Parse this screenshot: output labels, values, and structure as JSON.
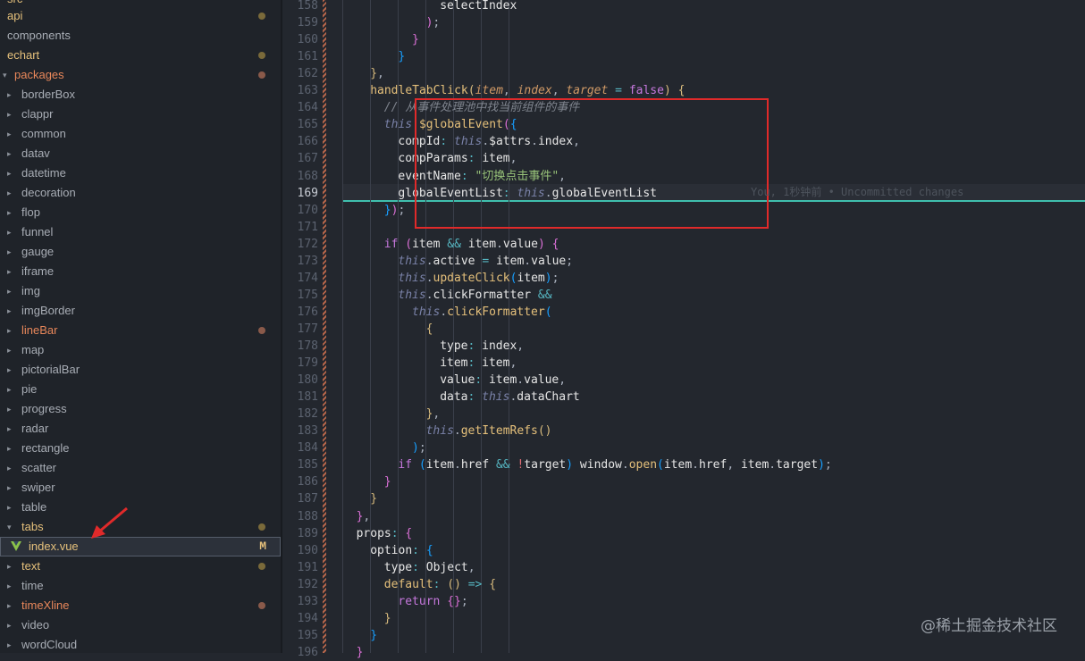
{
  "explorer": {
    "top_partial": "src",
    "items": [
      {
        "label": "api",
        "color": "yellow",
        "dot": "olive",
        "chevron": ""
      },
      {
        "label": "components",
        "color": "default",
        "dot": "",
        "chevron": ""
      },
      {
        "label": "echart",
        "color": "yellow",
        "dot": "olive",
        "chevron": ""
      },
      {
        "label": "packages",
        "color": "orange",
        "dot": "red",
        "chevron": "▾"
      },
      {
        "label": "borderBox",
        "color": "default",
        "dot": "",
        "chevron": "▸"
      },
      {
        "label": "clappr",
        "color": "default",
        "dot": "",
        "chevron": "▸"
      },
      {
        "label": "common",
        "color": "default",
        "dot": "",
        "chevron": "▸"
      },
      {
        "label": "datav",
        "color": "default",
        "dot": "",
        "chevron": "▸"
      },
      {
        "label": "datetime",
        "color": "default",
        "dot": "",
        "chevron": "▸"
      },
      {
        "label": "decoration",
        "color": "default",
        "dot": "",
        "chevron": "▸"
      },
      {
        "label": "flop",
        "color": "default",
        "dot": "",
        "chevron": "▸"
      },
      {
        "label": "funnel",
        "color": "default",
        "dot": "",
        "chevron": "▸"
      },
      {
        "label": "gauge",
        "color": "default",
        "dot": "",
        "chevron": "▸"
      },
      {
        "label": "iframe",
        "color": "default",
        "dot": "",
        "chevron": "▸"
      },
      {
        "label": "img",
        "color": "default",
        "dot": "",
        "chevron": "▸"
      },
      {
        "label": "imgBorder",
        "color": "default",
        "dot": "",
        "chevron": "▸"
      },
      {
        "label": "lineBar",
        "color": "orange",
        "dot": "red",
        "chevron": "▸"
      },
      {
        "label": "map",
        "color": "default",
        "dot": "",
        "chevron": "▸"
      },
      {
        "label": "pictorialBar",
        "color": "default",
        "dot": "",
        "chevron": "▸"
      },
      {
        "label": "pie",
        "color": "default",
        "dot": "",
        "chevron": "▸"
      },
      {
        "label": "progress",
        "color": "default",
        "dot": "",
        "chevron": "▸"
      },
      {
        "label": "radar",
        "color": "default",
        "dot": "",
        "chevron": "▸"
      },
      {
        "label": "rectangle",
        "color": "default",
        "dot": "",
        "chevron": "▸"
      },
      {
        "label": "scatter",
        "color": "default",
        "dot": "",
        "chevron": "▸"
      },
      {
        "label": "swiper",
        "color": "default",
        "dot": "",
        "chevron": "▸"
      },
      {
        "label": "table",
        "color": "default",
        "dot": "",
        "chevron": "▸"
      },
      {
        "label": "tabs",
        "color": "yellow",
        "dot": "olive",
        "chevron": "▾"
      },
      {
        "label": "index.vue",
        "color": "yellow",
        "dot": "",
        "badge": "M",
        "chevron": "",
        "file": true
      },
      {
        "label": "text",
        "color": "yellow",
        "dot": "olive",
        "chevron": "▸"
      },
      {
        "label": "time",
        "color": "default",
        "dot": "",
        "chevron": "▸"
      },
      {
        "label": "timeXline",
        "color": "orange",
        "dot": "red",
        "chevron": "▸"
      },
      {
        "label": "video",
        "color": "default",
        "dot": "",
        "chevron": "▸"
      },
      {
        "label": "wordCloud",
        "color": "default",
        "dot": "",
        "chevron": "▸"
      }
    ]
  },
  "editor": {
    "active_line": "169",
    "blame": "You, 1秒钟前 • Uncommitted changes",
    "lines": [
      {
        "n": "158",
        "indent": 14,
        "tokens": [
          [
            "prop",
            "selectIndex"
          ]
        ]
      },
      {
        "n": "159",
        "indent": 12,
        "tokens": [
          [
            "brace2",
            ")"
          ],
          [
            "pun",
            ";"
          ]
        ]
      },
      {
        "n": "160",
        "indent": 10,
        "tokens": [
          [
            "brace2",
            "}"
          ]
        ]
      },
      {
        "n": "161",
        "indent": 8,
        "tokens": [
          [
            "brace3",
            "}"
          ]
        ]
      },
      {
        "n": "162",
        "indent": 4,
        "tokens": [
          [
            "brace",
            "}"
          ],
          [
            "pun",
            ","
          ]
        ]
      },
      {
        "n": "163",
        "indent": 4,
        "tokens": [
          [
            "fn",
            "handleTabClick"
          ],
          [
            "brace",
            "("
          ],
          [
            "prm",
            "item"
          ],
          [
            "pun",
            ", "
          ],
          [
            "prm",
            "index"
          ],
          [
            "pun",
            ", "
          ],
          [
            "prm",
            "target"
          ],
          [
            "op",
            " = "
          ],
          [
            "kw",
            "false"
          ],
          [
            "brace",
            ")"
          ],
          [
            "pun",
            " "
          ],
          [
            "brace",
            "{"
          ]
        ]
      },
      {
        "n": "164",
        "indent": 6,
        "tokens": [
          [
            "cmt",
            "// 从事件处理池中找当前组件的事件"
          ]
        ]
      },
      {
        "n": "165",
        "indent": 6,
        "tokens": [
          [
            "th",
            "this"
          ],
          [
            "pun",
            "."
          ],
          [
            "fn",
            "$globalEvent"
          ],
          [
            "brace2",
            "("
          ],
          [
            "brace3",
            "{"
          ]
        ]
      },
      {
        "n": "166",
        "indent": 8,
        "tokens": [
          [
            "prop",
            "compId"
          ],
          [
            "op",
            ": "
          ],
          [
            "th",
            "this"
          ],
          [
            "pun",
            "."
          ],
          [
            "prop",
            "$attrs"
          ],
          [
            "pun",
            "."
          ],
          [
            "prop",
            "index"
          ],
          [
            "pun",
            ","
          ]
        ]
      },
      {
        "n": "167",
        "indent": 8,
        "tokens": [
          [
            "prop",
            "compParams"
          ],
          [
            "op",
            ": "
          ],
          [
            "prop",
            "item"
          ],
          [
            "pun",
            ","
          ]
        ]
      },
      {
        "n": "168",
        "indent": 8,
        "tokens": [
          [
            "prop",
            "eventName"
          ],
          [
            "op",
            ": "
          ],
          [
            "str",
            "\"切换点击事件\""
          ],
          [
            "pun",
            ","
          ]
        ]
      },
      {
        "n": "169",
        "indent": 8,
        "tokens": [
          [
            "prop",
            "globalEventList"
          ],
          [
            "op",
            ": "
          ],
          [
            "th",
            "this"
          ],
          [
            "pun",
            "."
          ],
          [
            "prop",
            "globalEventList"
          ]
        ]
      },
      {
        "n": "170",
        "indent": 6,
        "tokens": [
          [
            "brace3",
            "}"
          ],
          [
            "brace2",
            ")"
          ],
          [
            "pun",
            ";"
          ]
        ]
      },
      {
        "n": "171",
        "indent": 0,
        "tokens": []
      },
      {
        "n": "172",
        "indent": 6,
        "tokens": [
          [
            "kw",
            "if"
          ],
          [
            "pun",
            " "
          ],
          [
            "brace2",
            "("
          ],
          [
            "prop",
            "item"
          ],
          [
            "op",
            " && "
          ],
          [
            "prop",
            "item"
          ],
          [
            "pun",
            "."
          ],
          [
            "prop",
            "value"
          ],
          [
            "brace2",
            ")"
          ],
          [
            "pun",
            " "
          ],
          [
            "brace2",
            "{"
          ]
        ]
      },
      {
        "n": "173",
        "indent": 8,
        "tokens": [
          [
            "th",
            "this"
          ],
          [
            "pun",
            "."
          ],
          [
            "prop",
            "active"
          ],
          [
            "op",
            " = "
          ],
          [
            "prop",
            "item"
          ],
          [
            "pun",
            "."
          ],
          [
            "prop",
            "value"
          ],
          [
            "pun",
            ";"
          ]
        ]
      },
      {
        "n": "174",
        "indent": 8,
        "tokens": [
          [
            "th",
            "this"
          ],
          [
            "pun",
            "."
          ],
          [
            "fn",
            "updateClick"
          ],
          [
            "brace3",
            "("
          ],
          [
            "prop",
            "item"
          ],
          [
            "brace3",
            ")"
          ],
          [
            "pun",
            ";"
          ]
        ]
      },
      {
        "n": "175",
        "indent": 8,
        "tokens": [
          [
            "th",
            "this"
          ],
          [
            "pun",
            "."
          ],
          [
            "prop",
            "clickFormatter"
          ],
          [
            "op",
            " &&"
          ]
        ]
      },
      {
        "n": "176",
        "indent": 10,
        "tokens": [
          [
            "th",
            "this"
          ],
          [
            "pun",
            "."
          ],
          [
            "fn",
            "clickFormatter"
          ],
          [
            "brace3",
            "("
          ]
        ]
      },
      {
        "n": "177",
        "indent": 12,
        "tokens": [
          [
            "brace",
            "{"
          ]
        ]
      },
      {
        "n": "178",
        "indent": 14,
        "tokens": [
          [
            "prop",
            "type"
          ],
          [
            "op",
            ": "
          ],
          [
            "prop",
            "index"
          ],
          [
            "pun",
            ","
          ]
        ]
      },
      {
        "n": "179",
        "indent": 14,
        "tokens": [
          [
            "prop",
            "item"
          ],
          [
            "op",
            ": "
          ],
          [
            "prop",
            "item"
          ],
          [
            "pun",
            ","
          ]
        ]
      },
      {
        "n": "180",
        "indent": 14,
        "tokens": [
          [
            "prop",
            "value"
          ],
          [
            "op",
            ": "
          ],
          [
            "prop",
            "item"
          ],
          [
            "pun",
            "."
          ],
          [
            "prop",
            "value"
          ],
          [
            "pun",
            ","
          ]
        ]
      },
      {
        "n": "181",
        "indent": 14,
        "tokens": [
          [
            "prop",
            "data"
          ],
          [
            "op",
            ": "
          ],
          [
            "th",
            "this"
          ],
          [
            "pun",
            "."
          ],
          [
            "prop",
            "dataChart"
          ]
        ]
      },
      {
        "n": "182",
        "indent": 12,
        "tokens": [
          [
            "brace",
            "}"
          ],
          [
            "pun",
            ","
          ]
        ]
      },
      {
        "n": "183",
        "indent": 12,
        "tokens": [
          [
            "th",
            "this"
          ],
          [
            "pun",
            "."
          ],
          [
            "fn",
            "getItemRefs"
          ],
          [
            "brace",
            "()"
          ]
        ]
      },
      {
        "n": "184",
        "indent": 10,
        "tokens": [
          [
            "brace3",
            ")"
          ],
          [
            "pun",
            ";"
          ]
        ]
      },
      {
        "n": "185",
        "indent": 8,
        "tokens": [
          [
            "kw",
            "if"
          ],
          [
            "pun",
            " "
          ],
          [
            "brace3",
            "("
          ],
          [
            "prop",
            "item"
          ],
          [
            "pun",
            "."
          ],
          [
            "prop",
            "href"
          ],
          [
            "op",
            " && "
          ],
          [
            "key",
            "!"
          ],
          [
            "prop",
            "target"
          ],
          [
            "brace3",
            ")"
          ],
          [
            "pun",
            " "
          ],
          [
            "prop",
            "window"
          ],
          [
            "pun",
            "."
          ],
          [
            "fn",
            "open"
          ],
          [
            "brace3",
            "("
          ],
          [
            "prop",
            "item"
          ],
          [
            "pun",
            "."
          ],
          [
            "prop",
            "href"
          ],
          [
            "pun",
            ", "
          ],
          [
            "prop",
            "item"
          ],
          [
            "pun",
            "."
          ],
          [
            "prop",
            "target"
          ],
          [
            "brace3",
            ")"
          ],
          [
            "pun",
            ";"
          ]
        ]
      },
      {
        "n": "186",
        "indent": 6,
        "tokens": [
          [
            "brace2",
            "}"
          ]
        ]
      },
      {
        "n": "187",
        "indent": 4,
        "tokens": [
          [
            "brace",
            "}"
          ]
        ]
      },
      {
        "n": "188",
        "indent": 2,
        "tokens": [
          [
            "brace2",
            "}"
          ],
          [
            "pun",
            ","
          ]
        ]
      },
      {
        "n": "189",
        "indent": 2,
        "tokens": [
          [
            "prop",
            "props"
          ],
          [
            "op",
            ": "
          ],
          [
            "brace2",
            "{"
          ]
        ]
      },
      {
        "n": "190",
        "indent": 4,
        "tokens": [
          [
            "prop",
            "option"
          ],
          [
            "op",
            ": "
          ],
          [
            "brace3",
            "{"
          ]
        ]
      },
      {
        "n": "191",
        "indent": 6,
        "tokens": [
          [
            "prop",
            "type"
          ],
          [
            "op",
            ": "
          ],
          [
            "prop",
            "Object"
          ],
          [
            "pun",
            ","
          ]
        ]
      },
      {
        "n": "192",
        "indent": 6,
        "tokens": [
          [
            "fn",
            "default"
          ],
          [
            "op",
            ": "
          ],
          [
            "brace",
            "()"
          ],
          [
            "op",
            " => "
          ],
          [
            "brace",
            "{"
          ]
        ]
      },
      {
        "n": "193",
        "indent": 8,
        "tokens": [
          [
            "kw",
            "return"
          ],
          [
            "pun",
            " "
          ],
          [
            "brace2",
            "{}"
          ],
          [
            "pun",
            ";"
          ]
        ]
      },
      {
        "n": "194",
        "indent": 6,
        "tokens": [
          [
            "brace",
            "}"
          ]
        ]
      },
      {
        "n": "195",
        "indent": 4,
        "tokens": [
          [
            "brace3",
            "}"
          ]
        ]
      },
      {
        "n": "196",
        "indent": 2,
        "tokens": [
          [
            "brace2",
            "}"
          ]
        ]
      }
    ]
  },
  "watermark": "@稀土掘金技术社区",
  "colors": {
    "highlight_box": "#e02a2a",
    "cursor_line": "#3fbfad",
    "arrow": "#e02a2a"
  }
}
